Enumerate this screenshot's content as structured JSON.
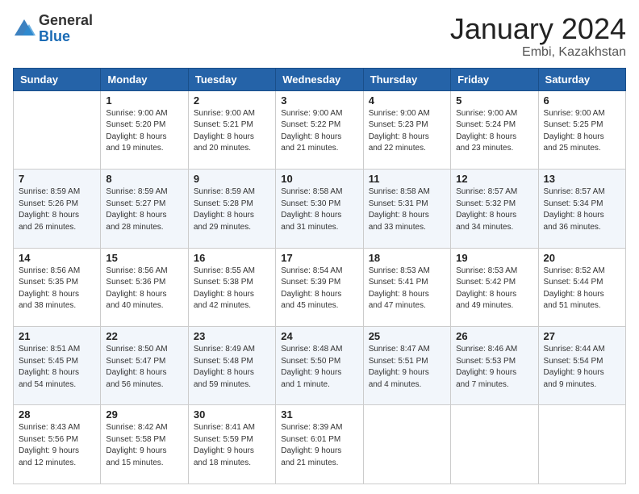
{
  "logo": {
    "general": "General",
    "blue": "Blue"
  },
  "title": {
    "month": "January 2024",
    "location": "Embi, Kazakhstan"
  },
  "calendar": {
    "headers": [
      "Sunday",
      "Monday",
      "Tuesday",
      "Wednesday",
      "Thursday",
      "Friday",
      "Saturday"
    ],
    "weeks": [
      [
        {
          "day": "",
          "info": ""
        },
        {
          "day": "1",
          "info": "Sunrise: 9:00 AM\nSunset: 5:20 PM\nDaylight: 8 hours\nand 19 minutes."
        },
        {
          "day": "2",
          "info": "Sunrise: 9:00 AM\nSunset: 5:21 PM\nDaylight: 8 hours\nand 20 minutes."
        },
        {
          "day": "3",
          "info": "Sunrise: 9:00 AM\nSunset: 5:22 PM\nDaylight: 8 hours\nand 21 minutes."
        },
        {
          "day": "4",
          "info": "Sunrise: 9:00 AM\nSunset: 5:23 PM\nDaylight: 8 hours\nand 22 minutes."
        },
        {
          "day": "5",
          "info": "Sunrise: 9:00 AM\nSunset: 5:24 PM\nDaylight: 8 hours\nand 23 minutes."
        },
        {
          "day": "6",
          "info": "Sunrise: 9:00 AM\nSunset: 5:25 PM\nDaylight: 8 hours\nand 25 minutes."
        }
      ],
      [
        {
          "day": "7",
          "info": "Sunrise: 8:59 AM\nSunset: 5:26 PM\nDaylight: 8 hours\nand 26 minutes."
        },
        {
          "day": "8",
          "info": "Sunrise: 8:59 AM\nSunset: 5:27 PM\nDaylight: 8 hours\nand 28 minutes."
        },
        {
          "day": "9",
          "info": "Sunrise: 8:59 AM\nSunset: 5:28 PM\nDaylight: 8 hours\nand 29 minutes."
        },
        {
          "day": "10",
          "info": "Sunrise: 8:58 AM\nSunset: 5:30 PM\nDaylight: 8 hours\nand 31 minutes."
        },
        {
          "day": "11",
          "info": "Sunrise: 8:58 AM\nSunset: 5:31 PM\nDaylight: 8 hours\nand 33 minutes."
        },
        {
          "day": "12",
          "info": "Sunrise: 8:57 AM\nSunset: 5:32 PM\nDaylight: 8 hours\nand 34 minutes."
        },
        {
          "day": "13",
          "info": "Sunrise: 8:57 AM\nSunset: 5:34 PM\nDaylight: 8 hours\nand 36 minutes."
        }
      ],
      [
        {
          "day": "14",
          "info": "Sunrise: 8:56 AM\nSunset: 5:35 PM\nDaylight: 8 hours\nand 38 minutes."
        },
        {
          "day": "15",
          "info": "Sunrise: 8:56 AM\nSunset: 5:36 PM\nDaylight: 8 hours\nand 40 minutes."
        },
        {
          "day": "16",
          "info": "Sunrise: 8:55 AM\nSunset: 5:38 PM\nDaylight: 8 hours\nand 42 minutes."
        },
        {
          "day": "17",
          "info": "Sunrise: 8:54 AM\nSunset: 5:39 PM\nDaylight: 8 hours\nand 45 minutes."
        },
        {
          "day": "18",
          "info": "Sunrise: 8:53 AM\nSunset: 5:41 PM\nDaylight: 8 hours\nand 47 minutes."
        },
        {
          "day": "19",
          "info": "Sunrise: 8:53 AM\nSunset: 5:42 PM\nDaylight: 8 hours\nand 49 minutes."
        },
        {
          "day": "20",
          "info": "Sunrise: 8:52 AM\nSunset: 5:44 PM\nDaylight: 8 hours\nand 51 minutes."
        }
      ],
      [
        {
          "day": "21",
          "info": "Sunrise: 8:51 AM\nSunset: 5:45 PM\nDaylight: 8 hours\nand 54 minutes."
        },
        {
          "day": "22",
          "info": "Sunrise: 8:50 AM\nSunset: 5:47 PM\nDaylight: 8 hours\nand 56 minutes."
        },
        {
          "day": "23",
          "info": "Sunrise: 8:49 AM\nSunset: 5:48 PM\nDaylight: 8 hours\nand 59 minutes."
        },
        {
          "day": "24",
          "info": "Sunrise: 8:48 AM\nSunset: 5:50 PM\nDaylight: 9 hours\nand 1 minute."
        },
        {
          "day": "25",
          "info": "Sunrise: 8:47 AM\nSunset: 5:51 PM\nDaylight: 9 hours\nand 4 minutes."
        },
        {
          "day": "26",
          "info": "Sunrise: 8:46 AM\nSunset: 5:53 PM\nDaylight: 9 hours\nand 7 minutes."
        },
        {
          "day": "27",
          "info": "Sunrise: 8:44 AM\nSunset: 5:54 PM\nDaylight: 9 hours\nand 9 minutes."
        }
      ],
      [
        {
          "day": "28",
          "info": "Sunrise: 8:43 AM\nSunset: 5:56 PM\nDaylight: 9 hours\nand 12 minutes."
        },
        {
          "day": "29",
          "info": "Sunrise: 8:42 AM\nSunset: 5:58 PM\nDaylight: 9 hours\nand 15 minutes."
        },
        {
          "day": "30",
          "info": "Sunrise: 8:41 AM\nSunset: 5:59 PM\nDaylight: 9 hours\nand 18 minutes."
        },
        {
          "day": "31",
          "info": "Sunrise: 8:39 AM\nSunset: 6:01 PM\nDaylight: 9 hours\nand 21 minutes."
        },
        {
          "day": "",
          "info": ""
        },
        {
          "day": "",
          "info": ""
        },
        {
          "day": "",
          "info": ""
        }
      ]
    ]
  }
}
